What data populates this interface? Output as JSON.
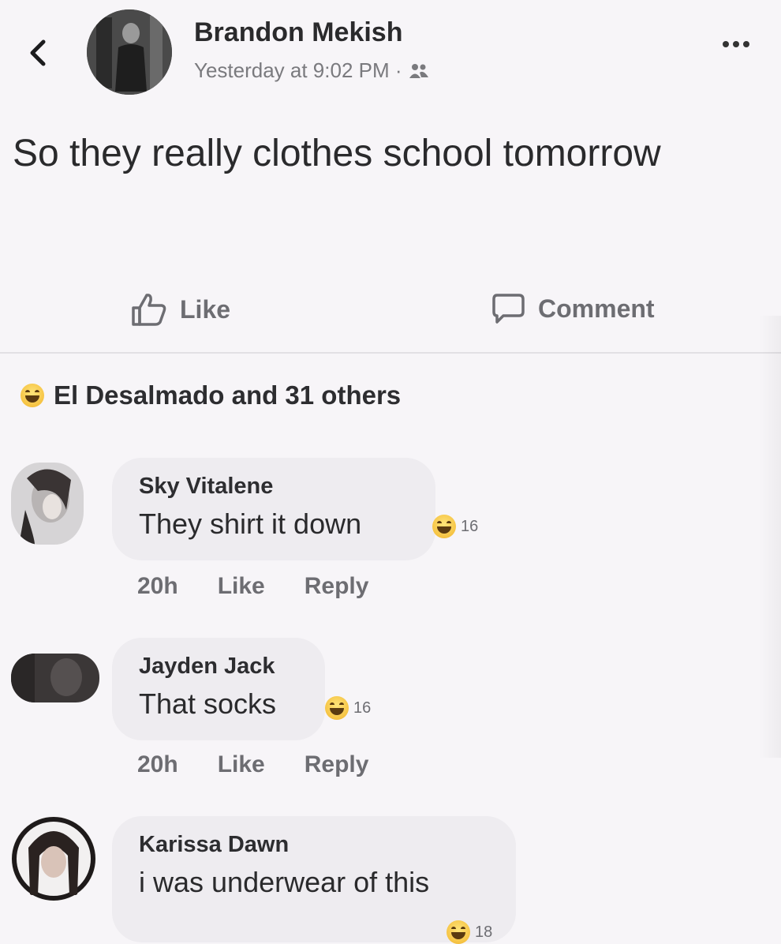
{
  "header": {
    "author_name": "Brandon Mekish",
    "timestamp": "Yesterday at 9:02 PM ·",
    "audience_icon": "friends-icon",
    "back_icon": "chevron-left-icon",
    "more_icon": "more-dots-icon"
  },
  "post": {
    "text": "So they really clothes school tomorrow"
  },
  "actions": {
    "like_label": "Like",
    "comment_label": "Comment"
  },
  "reactions_summary": {
    "emoji": "laughing-emoji",
    "text": "El Desalmado and 31 others"
  },
  "comments": [
    {
      "name": "Sky Vitalene",
      "text": "They shirt it down",
      "reaction_count": "16",
      "time": "20h",
      "like_label": "Like",
      "reply_label": "Reply"
    },
    {
      "name": "Jayden Jack",
      "text": "That socks",
      "reaction_count": "16",
      "time": "20h",
      "like_label": "Like",
      "reply_label": "Reply"
    },
    {
      "name": "Karissa Dawn",
      "text": "i was underwear of this",
      "reaction_count": "18"
    }
  ],
  "colors": {
    "background": "#f7f5f8",
    "bubble": "#eeecf0",
    "secondary_text": "#6d6d72",
    "emoji_yellow": "#f6c343"
  }
}
